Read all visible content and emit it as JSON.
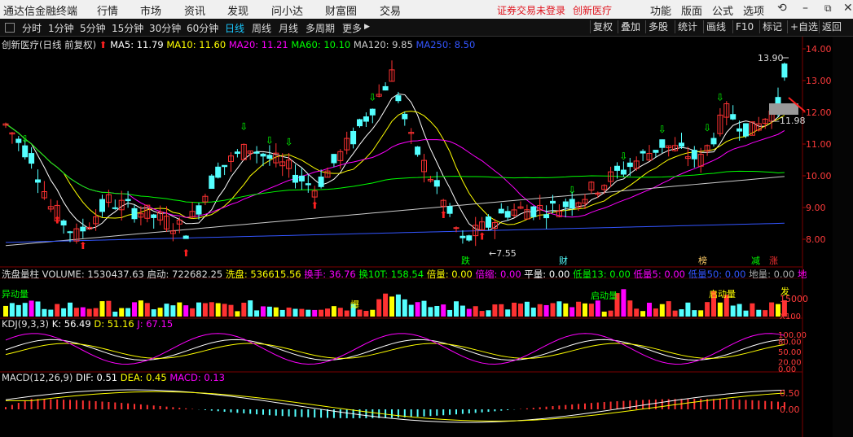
{
  "menubar": {
    "app_title": "通达信金融终端",
    "menus": [
      "行情",
      "市场",
      "资讯",
      "发现",
      "问小达",
      "财富圈",
      "交易"
    ],
    "warning": "证券交易未登录",
    "stock_name": "创新医疗",
    "right_menus": [
      "功能",
      "版面",
      "公式",
      "选项"
    ]
  },
  "toolbar": {
    "periods": [
      "分时",
      "1分钟",
      "5分钟",
      "15分钟",
      "30分钟",
      "60分钟",
      "日线",
      "周线",
      "月线",
      "多周期",
      "更多"
    ],
    "active_period": "日线",
    "tools": [
      "复权",
      "叠加",
      "多股",
      "统计",
      "画线",
      "F10",
      "标记",
      "+自选",
      "返回"
    ]
  },
  "main_legend": {
    "title": "创新医疗(日线 前复权)",
    "ma5": "MA5: 11.79",
    "ma10": "MA10: 11.60",
    "ma20": "MA20: 11.21",
    "ma60": "MA60: 10.10",
    "ma120": "MA120: 9.85",
    "ma250": "MA250: 8.50"
  },
  "price_axis": [
    "14.00",
    "13.00",
    "12.00",
    "11.00",
    "10.00",
    "9.00",
    "8.00"
  ],
  "annotations": {
    "high": "13.90",
    "low": "7.55",
    "cross": "11.98",
    "markers": [
      "跌",
      "财",
      "榜",
      "减",
      "涨"
    ]
  },
  "volume_legend": {
    "title": "洗盘量柱",
    "volume": "VOLUME: 1530437.63",
    "start": "启动: 722682.25",
    "wash": "洗盘: 536615.56",
    "turnover": "换手: 36.76",
    "turnover10": "换10T: 158.54",
    "times": "倍量: 0.00",
    "shrink": "倍缩: 0.00",
    "flat": "平量: 0.00",
    "low13": "低量13: 0.00",
    "low5": "低量5: 0.00",
    "low50": "低量50: 0.00",
    "ground": "地量: 0.00",
    "ground2": "地"
  },
  "volume_axis": {
    "label": "15000",
    "unit": "X100"
  },
  "volume_tags": [
    "异动量",
    "启动量",
    "启动量",
    "爆",
    "发"
  ],
  "kdj_legend": {
    "title": "KDJ(9,3,3)",
    "k": "K: 56.49",
    "d": "D: 51.16",
    "j": "J: 67.15"
  },
  "kdj_axis": [
    "100.00",
    "80.00",
    "50.00",
    "20.00",
    "0.00"
  ],
  "macd_legend": {
    "title": "MACD(12,26,9)",
    "dif": "DIF: 0.51",
    "dea": "DEA: 0.45",
    "macd": "MACD: 0.13"
  },
  "macd_axis": [
    "0.50",
    "0.00"
  ],
  "colors": {
    "up": "#ff3232",
    "down": "#54ffff",
    "ma5": "#ffffff",
    "ma10": "#ffff00",
    "ma20": "#ff00ff",
    "ma60": "#00ff00",
    "ma120": "#cccccc",
    "ma250": "#3355ff",
    "accent": "#19c8ff"
  }
}
